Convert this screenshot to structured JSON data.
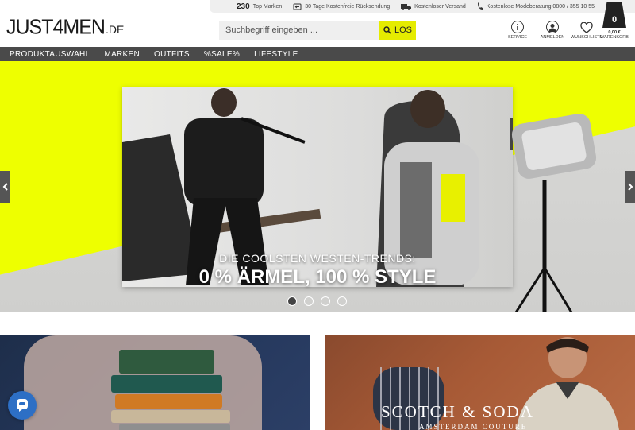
{
  "topbar": {
    "brand_count": "230",
    "brand_label": "Top Marken",
    "returns": "30 Tage Kostenfreie Rücksendung",
    "shipping": "Kostenloser Versand",
    "hotline": "Kostenlose Modeberatung 0800 / 355 10 55"
  },
  "header": {
    "logo_main": "JUST4MEN",
    "logo_tld": ".DE",
    "search_placeholder": "Suchbegriff eingeben ...",
    "search_button": "LOS",
    "icons": [
      {
        "label": "SERVICE",
        "icon": "info-icon"
      },
      {
        "label": "ANMELDEN",
        "icon": "user-icon"
      },
      {
        "label": "WUNSCHLISTE",
        "icon": "heart-icon"
      }
    ],
    "cart": {
      "count": "0",
      "price": "0,00 €",
      "label": "WARENKORB"
    }
  },
  "nav": [
    "PRODUKTAUSWAHL",
    "MARKEN",
    "OUTFITS",
    "%SALE%",
    "LIFESTYLE"
  ],
  "hero": {
    "caption_small": "DIE COOLSTEN WESTEN-TRENDS:",
    "caption_large": "0 % ÄRMEL, 100 % STYLE",
    "slides": 4,
    "active_slide": 1
  },
  "tiles": {
    "right_brand": "SCOTCH & SODA",
    "right_sub": "AMSTERDAM COUTURE"
  },
  "colors": {
    "accent": "#e5ec00",
    "hero_bg": "#eeff00",
    "nav_bg": "#4a4a4a",
    "chat": "#2d6fc5"
  }
}
